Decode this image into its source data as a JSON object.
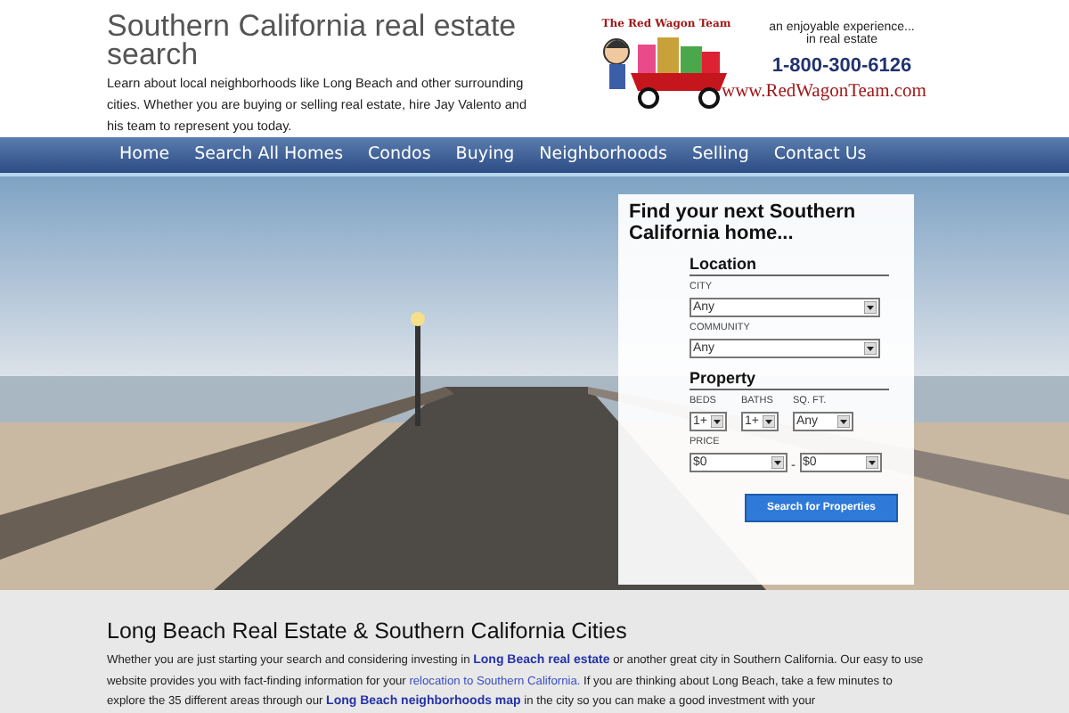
{
  "header": {
    "title": "Southern California real estate search",
    "tagline": "Learn about local neighborhoods like Long Beach and other surrounding cities. Whether you are buying or selling real estate, hire Jay Valento and his team to represent you today.",
    "logo": {
      "team": "The Red Wagon Team",
      "slogan_1": "an enjoyable experience...",
      "slogan_2": "in real estate",
      "phone": "1-800-300-6126",
      "website": "www.RedWagonTeam.com"
    }
  },
  "nav": [
    "Home",
    "Search All Homes",
    "Condos",
    "Buying",
    "Neighborhoods",
    "Selling",
    "Contact Us"
  ],
  "search_panel": {
    "title": "Find your next Southern California home...",
    "location": {
      "heading": "Location",
      "fields": [
        {
          "label": "CITY",
          "value": "Any"
        },
        {
          "label": "COMMUNITY",
          "value": "Any"
        }
      ]
    },
    "property": {
      "heading": "Property",
      "fields": [
        {
          "label": "BEDS",
          "value": "1+"
        },
        {
          "label": "BATHS",
          "value": "1+"
        },
        {
          "label": "SQ. FT.",
          "value": "Any"
        }
      ],
      "price_label": "PRICE",
      "price_min": "$0",
      "separator": "-",
      "price_max": "$0"
    },
    "button": "Search for Properties"
  },
  "content": {
    "heading": "Long Beach Real Estate & Southern California Cities",
    "paragraph": [
      {
        "kind": "text",
        "text": "Whether you are just starting your search and considering investing in "
      },
      {
        "kind": "link",
        "bold": true,
        "text": "Long Beach real estate"
      },
      {
        "kind": "text",
        "text": " or another great city in Southern California. Our easy to use website provides you with fact-finding information for your "
      },
      {
        "kind": "link",
        "bold": false,
        "text": "relocation to Southern California."
      },
      {
        "kind": "text",
        "text": " If you are thinking about Long Beach, take a few minutes to explore the 35 different areas through our "
      },
      {
        "kind": "link",
        "bold": true,
        "text": "Long Beach neighborhoods map"
      },
      {
        "kind": "text",
        "text": " in the city so you can make a good investment with your"
      }
    ]
  }
}
